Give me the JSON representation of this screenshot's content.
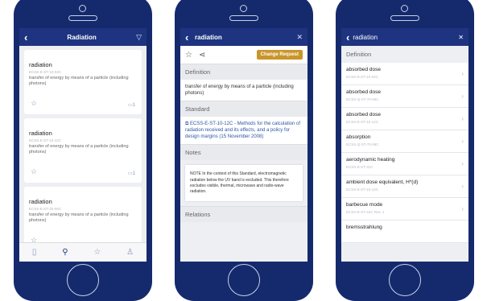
{
  "phone1": {
    "nav_title": "Radiation",
    "cards": [
      {
        "term": "radiation",
        "code": "ECSS-E-ST-10-04C",
        "desc": "transfer of energy by means of a particle (including photons)",
        "count": "1"
      },
      {
        "term": "radiation",
        "code": "ECSS-E-ST-10-12C",
        "desc": "transfer of energy by means of a particle (including photons)",
        "count": "1"
      },
      {
        "term": "radiation",
        "code": "ECSS-E-ST-20-06C",
        "desc": "transfer of energy by means of a particle (including photons)",
        "count": ""
      }
    ]
  },
  "phone2": {
    "nav_title": "radiation",
    "change_request": "Change Request",
    "definition_label": "Definition",
    "definition_text": "transfer of energy by means of a particle (including photons)",
    "standard_label": "Standard",
    "standard_text": "ECSS-E-ST-10-12C - Methods for the calculation of radiation received and its effects, and a policy for design margins (15 November 2008)",
    "notes_label": "Notes",
    "note_text": "NOTE In the context of this Standard, electromagnetic radiation below the UV band is excluded. This therefore excludes visible, thermal, microwave and radio-wave radiation.",
    "relations_label": "Relations"
  },
  "phone3": {
    "search_text": "radiation",
    "definition_label": "Definition",
    "rows": [
      {
        "term": "absorbed dose",
        "code": "ECSS-E-ST-10-04C"
      },
      {
        "term": "absorbed dose",
        "code": "ECSS-Q-ST-70-06C"
      },
      {
        "term": "absorbed dose",
        "code": "ECSS-E-ST-10-12C"
      },
      {
        "term": "absorption",
        "code": "ECSS-Q-ST-70-06C"
      },
      {
        "term": "aerodynamic heating",
        "code": "ECSS-E-ST-31C"
      },
      {
        "term": "ambient dose equivalent, H*(d)",
        "code": "ECSS-E-ST-10-12C"
      },
      {
        "term": "barbecue mode",
        "code": "ECSS-E-ST-31C Rev. 1"
      },
      {
        "term": "bremsstrahlung",
        "code": ""
      }
    ]
  }
}
